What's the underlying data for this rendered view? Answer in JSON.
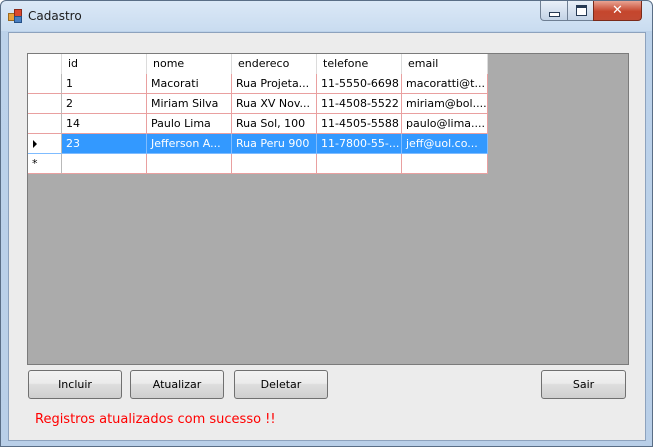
{
  "window": {
    "title": "Cadastro",
    "close_glyph": "✕"
  },
  "grid": {
    "columns": [
      "id",
      "nome",
      "endereco",
      "telefone",
      "email"
    ],
    "rows": [
      [
        "1",
        "Macorati",
        "Rua Projeta...",
        "11-5550-6698",
        "macoratti@t..."
      ],
      [
        "2",
        "Miriam Silva",
        "Rua XV Nov...",
        "11-4508-5522",
        "miriam@bol...."
      ],
      [
        "14",
        "Paulo Lima",
        "Rua Sol, 100",
        "11-4505-5588",
        "paulo@lima...."
      ],
      [
        "23",
        "Jefferson A...",
        "Rua Peru 900",
        "11-7800-55-...",
        "jeff@uol.co..."
      ]
    ],
    "selected_row_index": 3,
    "current_row_marker": "current-row-arrow-icon",
    "new_row_marker": "*"
  },
  "buttons": {
    "incluir": "Incluir",
    "atualizar": "Atualizar",
    "deletar": "Deletar",
    "sair": "Sair"
  },
  "status": {
    "message": "Registros atualizados com sucesso !!",
    "color": "#ff0000"
  },
  "colors": {
    "selection": "#3399ff",
    "gridline": "#e9a0a0",
    "grid_empty": "#ababab"
  }
}
